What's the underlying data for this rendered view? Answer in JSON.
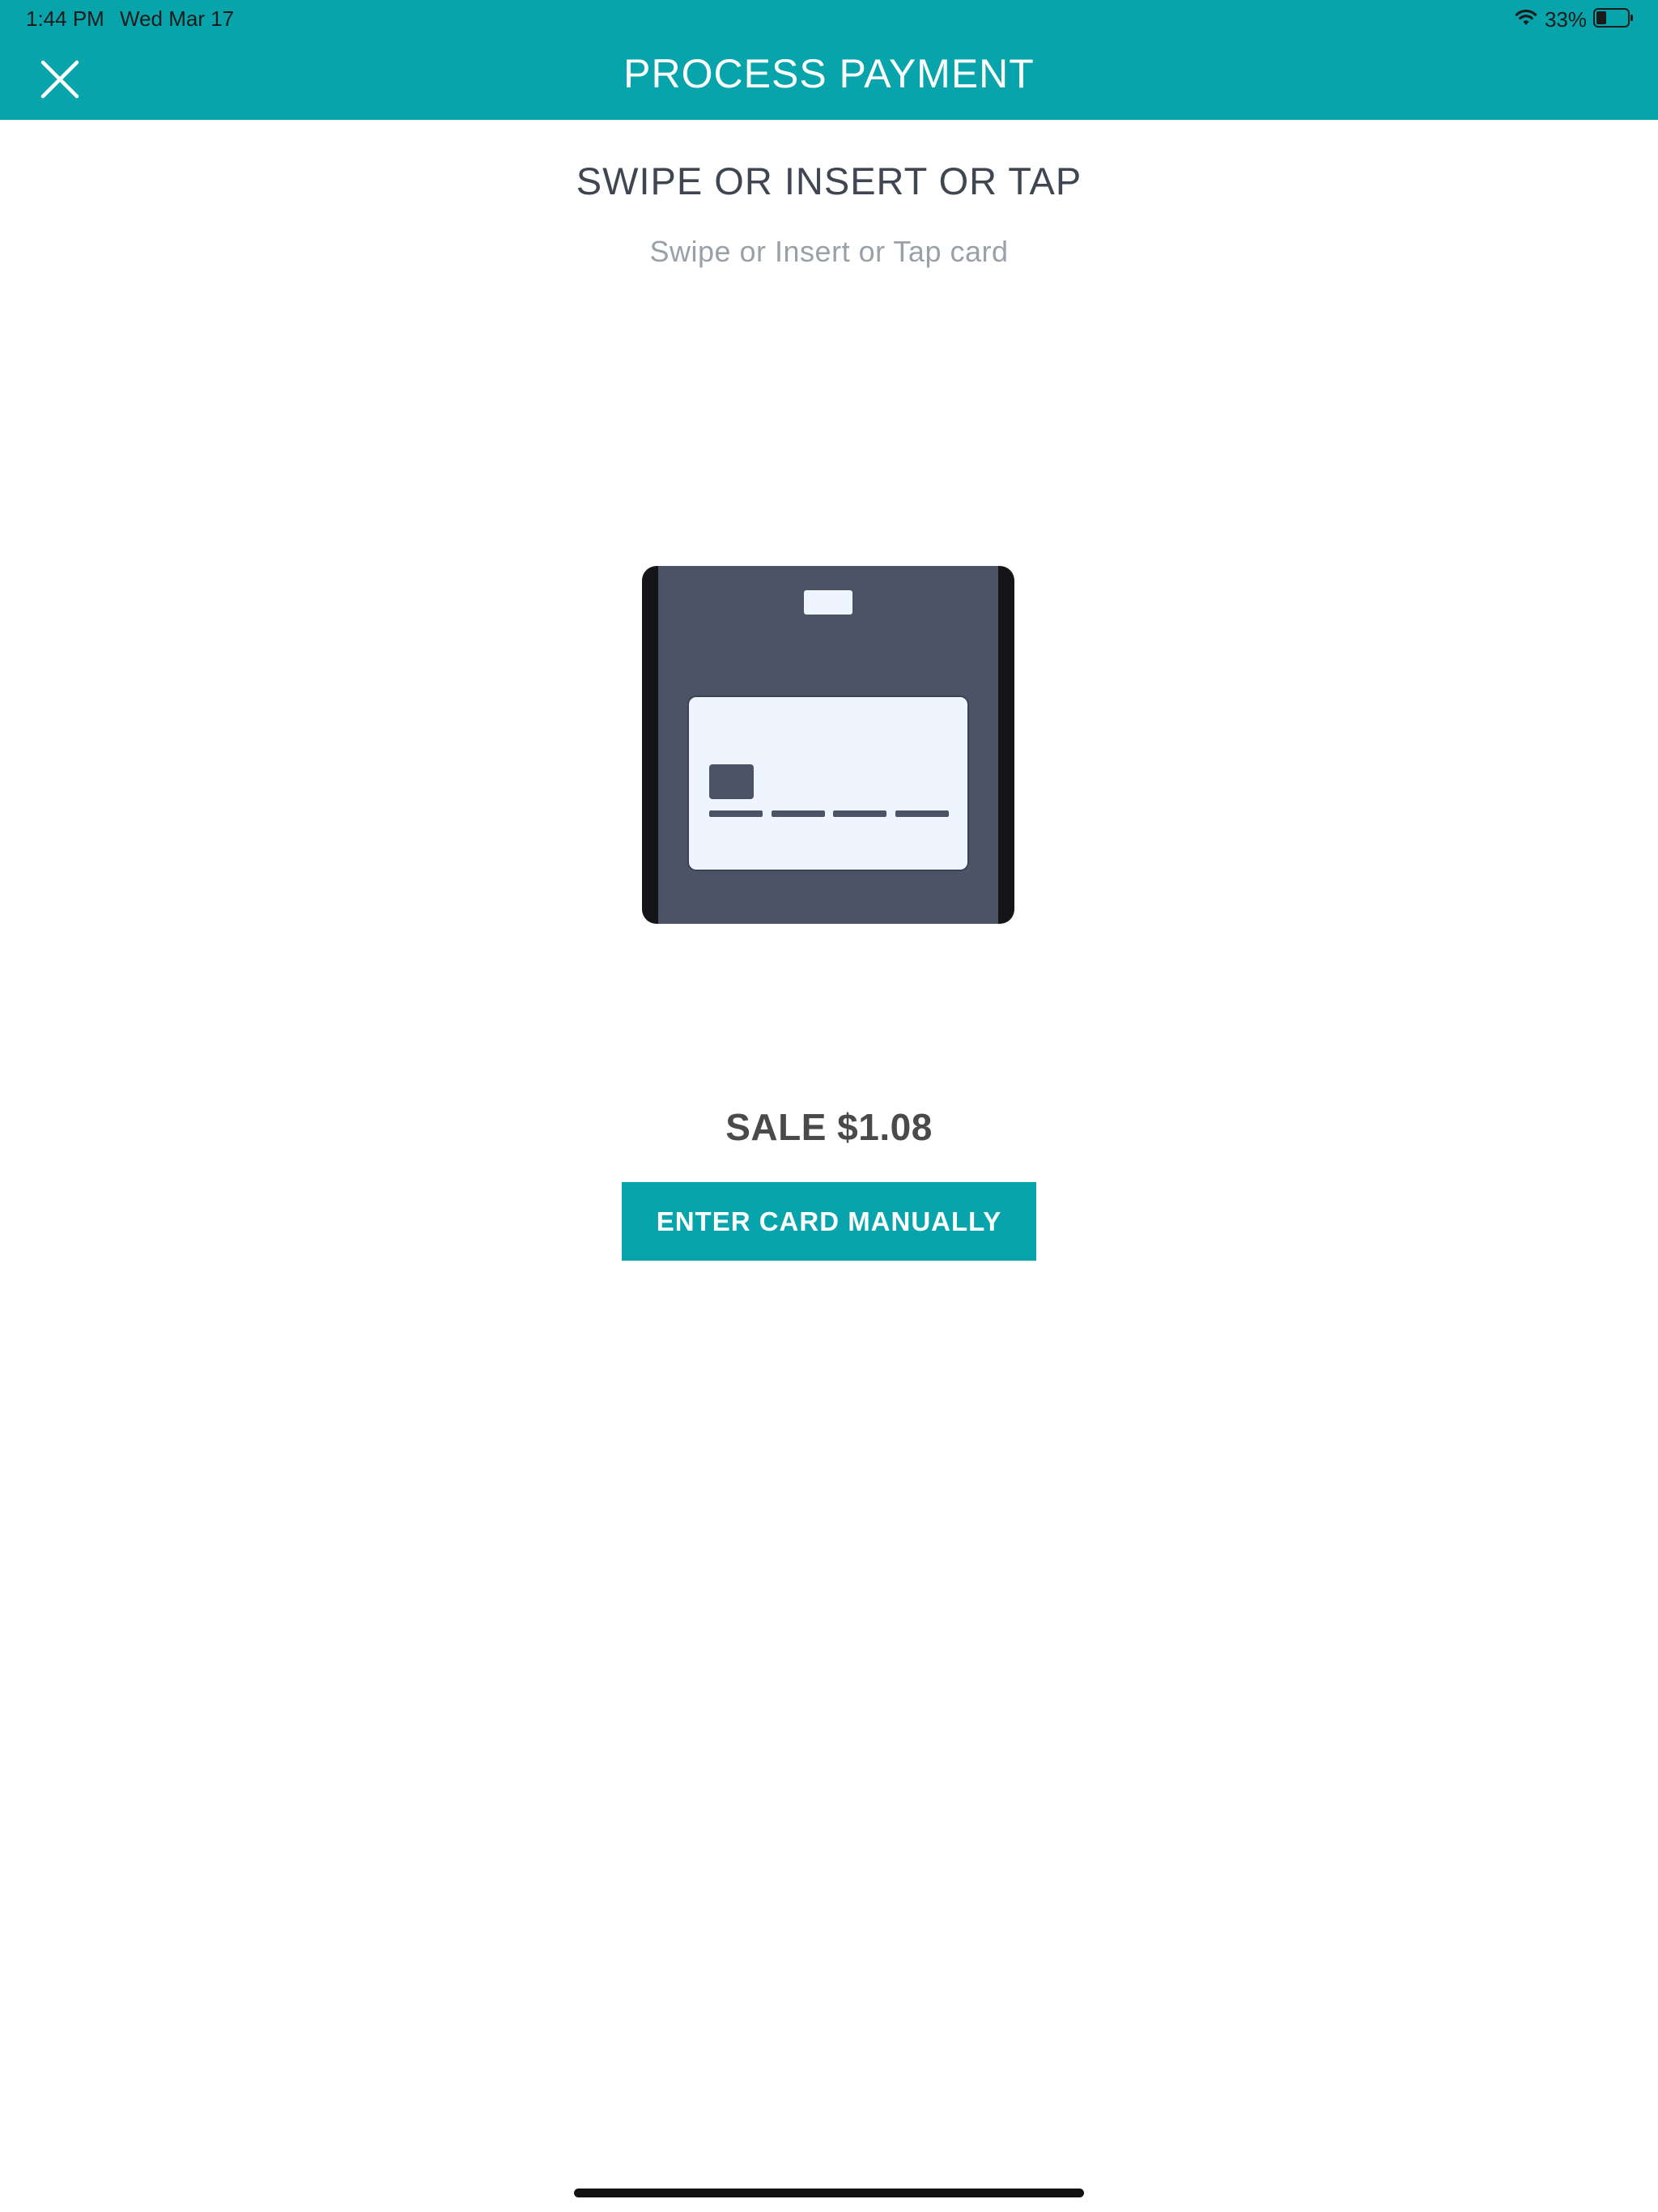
{
  "status_bar": {
    "time": "1:44 PM",
    "date": "Wed Mar 17",
    "battery_percent": "33%",
    "battery_level": 0.33,
    "icons": [
      "wifi-icon",
      "battery-icon"
    ]
  },
  "header": {
    "title": "PROCESS PAYMENT",
    "close_icon": "close-icon",
    "color": "#07a4ac"
  },
  "prompt": {
    "title": "SWIPE OR INSERT OR TAP",
    "subtitle": "Swipe or Insert or Tap card"
  },
  "illustration": {
    "icon": "card-reader-icon"
  },
  "sale": {
    "label": "SALE $1.08"
  },
  "actions": {
    "enter_card_manually": "ENTER CARD MANUALLY"
  },
  "colors": {
    "accent": "#07a4ac",
    "title_text": "#3f4652",
    "subtitle_text": "#9aa0a8"
  }
}
